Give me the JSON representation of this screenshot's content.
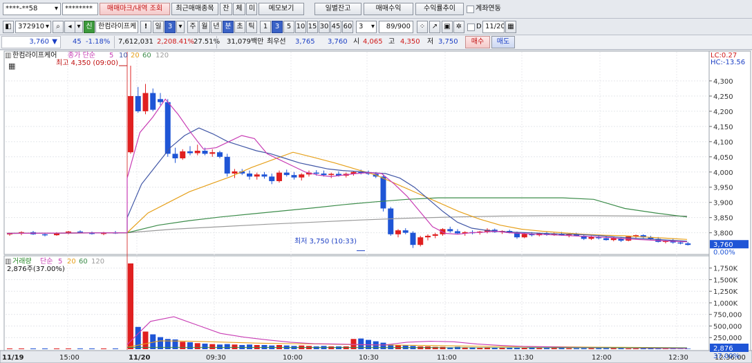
{
  "toolbar1": {
    "account_masked": "****-**58",
    "password_masked": "********",
    "trade_mark_btn": "매매마크/내역 조회",
    "recent_btn": "최근매매종목",
    "tab1": "잔",
    "tab2": "체",
    "tab3": "미",
    "memo_btn": "메모보기",
    "daily_balance_btn": "일별잔고",
    "trade_profit_btn": "매매수익",
    "return_trend_btn": "수익률추이",
    "account_link_label": "계좌연동"
  },
  "toolbar2": {
    "code": "372910",
    "name": "한컴라이프케",
    "exclaim": "!",
    "period_minute": "일",
    "period_value": "3",
    "periods": [
      "주",
      "월",
      "년",
      "분",
      "초",
      "틱"
    ],
    "intervals": [
      "1",
      "3",
      "5",
      "10",
      "15",
      "30",
      "45",
      "60"
    ],
    "interval_dropdown": "3",
    "count": "89",
    "count_total": "/900",
    "d_label": "D",
    "date": "11/20"
  },
  "quote": {
    "price": "3,760",
    "change": "45",
    "change_pct": "-1.18%",
    "volume": "7,612,031",
    "volume_ratio": "2,208.41%",
    "turnover_pct": "27.51%",
    "amount": "31,079백만",
    "best_bid_label": "최우선",
    "best_ask": "3,765",
    "best_bid": "3,760",
    "open_label": "시",
    "open": "4,065",
    "high_label": "고",
    "high": "4,350",
    "low_label": "저",
    "low": "3,750",
    "buy_btn": "매수",
    "sell_btn": "매도"
  },
  "price_panel": {
    "stock_name": "한컴라이프케어",
    "ma_label": "종가 단순",
    "ma_periods": [
      "5",
      "10",
      "20",
      "60",
      "120"
    ],
    "ma_colors": [
      "#c83cb4",
      "#4056a6",
      "#e6a01a",
      "#3c8c4a",
      "#9a9a9a"
    ],
    "lc": "LC:0.27",
    "hc": "HC:-13.56",
    "high_annotation": "최고 4,350 (09:00)",
    "low_annotation": "최저 3,750 (10:33)",
    "current_price_tag": "3,760",
    "current_pct_tag": "0.00%",
    "y_ticks": [
      "4,300",
      "4,250",
      "4,200",
      "4,150",
      "4,100",
      "4,050",
      "4,000",
      "3,950",
      "3,900",
      "3,850",
      "3,800"
    ]
  },
  "volume_panel": {
    "label": "거래량",
    "ma_label": "단순",
    "ma_periods": [
      "5",
      "20",
      "60",
      "120"
    ],
    "ma_colors": [
      "#c83cb4",
      "#e6a01a",
      "#3c8c4a",
      "#9a9a9a"
    ],
    "last_volume": "2,876주(37.00%)",
    "current_tag": "2,876",
    "current_tag2": "37.00%",
    "y_ticks": [
      "1,750K",
      "1,500K",
      "1,250K",
      "1,000K",
      "750,000",
      "500,000",
      "250,000"
    ]
  },
  "x_axis": {
    "labels": [
      "11/19",
      "15:00",
      "11/20",
      "09:30",
      "10:00",
      "10:30",
      "11:00",
      "11:30",
      "12:00",
      "12:30"
    ],
    "right_time": "12:36:00"
  },
  "chart_data": {
    "type": "candlestick",
    "price_ylim": [
      3740,
      4350
    ],
    "volume_ylim": [
      0,
      1850000
    ],
    "candles_prev_day": [
      {
        "o": 3795,
        "h": 3800,
        "l": 3790,
        "c": 3798
      },
      {
        "o": 3798,
        "h": 3805,
        "l": 3792,
        "c": 3802
      },
      {
        "o": 3802,
        "h": 3806,
        "l": 3793,
        "c": 3795
      },
      {
        "o": 3795,
        "h": 3800,
        "l": 3788,
        "c": 3792
      },
      {
        "o": 3792,
        "h": 3802,
        "l": 3790,
        "c": 3800
      },
      {
        "o": 3800,
        "h": 3806,
        "l": 3795,
        "c": 3804
      },
      {
        "o": 3804,
        "h": 3808,
        "l": 3798,
        "c": 3800
      },
      {
        "o": 3800,
        "h": 3804,
        "l": 3794,
        "c": 3796
      },
      {
        "o": 3796,
        "h": 3803,
        "l": 3792,
        "c": 3801
      },
      {
        "o": 3801,
        "h": 3806,
        "l": 3796,
        "c": 3798
      }
    ],
    "candles_today": [
      {
        "o": 4065,
        "h": 4350,
        "l": 4060,
        "c": 4250
      },
      {
        "o": 4250,
        "h": 4280,
        "l": 4195,
        "c": 4200
      },
      {
        "o": 4200,
        "h": 4290,
        "l": 4190,
        "c": 4260
      },
      {
        "o": 4260,
        "h": 4275,
        "l": 4200,
        "c": 4205
      },
      {
        "o": 4240,
        "h": 4260,
        "l": 4220,
        "c": 4230
      },
      {
        "o": 4230,
        "h": 4240,
        "l": 4050,
        "c": 4060
      },
      {
        "o": 4060,
        "h": 4080,
        "l": 4030,
        "c": 4045
      },
      {
        "o": 4045,
        "h": 4075,
        "l": 4040,
        "c": 4068
      },
      {
        "o": 4068,
        "h": 4085,
        "l": 4055,
        "c": 4062
      },
      {
        "o": 4062,
        "h": 4090,
        "l": 4055,
        "c": 4070
      },
      {
        "o": 4070,
        "h": 4080,
        "l": 4055,
        "c": 4060
      },
      {
        "o": 4060,
        "h": 4075,
        "l": 4050,
        "c": 4065
      },
      {
        "o": 4065,
        "h": 4070,
        "l": 4045,
        "c": 4050
      },
      {
        "o": 4050,
        "h": 4060,
        "l": 3985,
        "c": 3995
      },
      {
        "o": 3995,
        "h": 4010,
        "l": 3980,
        "c": 4002
      },
      {
        "o": 4002,
        "h": 4010,
        "l": 3990,
        "c": 3995
      },
      {
        "o": 3995,
        "h": 4005,
        "l": 3975,
        "c": 3985
      },
      {
        "o": 3985,
        "h": 3998,
        "l": 3975,
        "c": 3992
      },
      {
        "o": 3992,
        "h": 4000,
        "l": 3978,
        "c": 3985
      },
      {
        "o": 3985,
        "h": 3995,
        "l": 3960,
        "c": 3970
      },
      {
        "o": 3970,
        "h": 4005,
        "l": 3965,
        "c": 3998
      },
      {
        "o": 3998,
        "h": 4008,
        "l": 3985,
        "c": 3990
      },
      {
        "o": 3990,
        "h": 4000,
        "l": 3975,
        "c": 3982
      },
      {
        "o": 3982,
        "h": 3996,
        "l": 3972,
        "c": 3992
      },
      {
        "o": 3992,
        "h": 4005,
        "l": 3985,
        "c": 3998
      },
      {
        "o": 3998,
        "h": 4006,
        "l": 3988,
        "c": 3995
      },
      {
        "o": 3995,
        "h": 4005,
        "l": 3985,
        "c": 3990
      },
      {
        "o": 3990,
        "h": 3998,
        "l": 3980,
        "c": 3994
      },
      {
        "o": 3994,
        "h": 4002,
        "l": 3985,
        "c": 3988
      },
      {
        "o": 3988,
        "h": 3998,
        "l": 3982,
        "c": 3994
      },
      {
        "o": 3994,
        "h": 4004,
        "l": 3988,
        "c": 4000
      },
      {
        "o": 4000,
        "h": 4008,
        "l": 3992,
        "c": 3998
      },
      {
        "o": 3998,
        "h": 4005,
        "l": 3990,
        "c": 3994
      },
      {
        "o": 3994,
        "h": 4000,
        "l": 3980,
        "c": 3985
      },
      {
        "o": 3985,
        "h": 3990,
        "l": 3870,
        "c": 3880
      },
      {
        "o": 3880,
        "h": 3885,
        "l": 3790,
        "c": 3795
      },
      {
        "o": 3795,
        "h": 3812,
        "l": 3785,
        "c": 3808
      },
      {
        "o": 3808,
        "h": 3815,
        "l": 3795,
        "c": 3800
      },
      {
        "o": 3800,
        "h": 3805,
        "l": 3750,
        "c": 3760
      },
      {
        "o": 3760,
        "h": 3790,
        "l": 3755,
        "c": 3785
      },
      {
        "o": 3785,
        "h": 3795,
        "l": 3775,
        "c": 3790
      },
      {
        "o": 3790,
        "h": 3800,
        "l": 3782,
        "c": 3795
      },
      {
        "o": 3795,
        "h": 3815,
        "l": 3790,
        "c": 3812
      },
      {
        "o": 3812,
        "h": 3820,
        "l": 3800,
        "c": 3805
      },
      {
        "o": 3805,
        "h": 3812,
        "l": 3795,
        "c": 3798
      },
      {
        "o": 3798,
        "h": 3805,
        "l": 3790,
        "c": 3802
      },
      {
        "o": 3802,
        "h": 3808,
        "l": 3795,
        "c": 3800
      },
      {
        "o": 3800,
        "h": 3806,
        "l": 3794,
        "c": 3804
      },
      {
        "o": 3804,
        "h": 3815,
        "l": 3798,
        "c": 3810
      },
      {
        "o": 3810,
        "h": 3814,
        "l": 3800,
        "c": 3802
      },
      {
        "o": 3802,
        "h": 3808,
        "l": 3796,
        "c": 3806
      },
      {
        "o": 3806,
        "h": 3810,
        "l": 3798,
        "c": 3800
      },
      {
        "o": 3800,
        "h": 3804,
        "l": 3780,
        "c": 3785
      },
      {
        "o": 3785,
        "h": 3800,
        "l": 3782,
        "c": 3796
      },
      {
        "o": 3796,
        "h": 3802,
        "l": 3788,
        "c": 3792
      },
      {
        "o": 3792,
        "h": 3800,
        "l": 3788,
        "c": 3798
      },
      {
        "o": 3798,
        "h": 3804,
        "l": 3790,
        "c": 3794
      },
      {
        "o": 3794,
        "h": 3800,
        "l": 3790,
        "c": 3797
      },
      {
        "o": 3797,
        "h": 3803,
        "l": 3790,
        "c": 3792
      },
      {
        "o": 3792,
        "h": 3798,
        "l": 3785,
        "c": 3795
      },
      {
        "o": 3795,
        "h": 3800,
        "l": 3788,
        "c": 3790
      },
      {
        "o": 3790,
        "h": 3796,
        "l": 3776,
        "c": 3780
      },
      {
        "o": 3780,
        "h": 3790,
        "l": 3776,
        "c": 3786
      },
      {
        "o": 3786,
        "h": 3792,
        "l": 3778,
        "c": 3782
      },
      {
        "o": 3782,
        "h": 3788,
        "l": 3774,
        "c": 3776
      },
      {
        "o": 3776,
        "h": 3786,
        "l": 3772,
        "c": 3782
      },
      {
        "o": 3782,
        "h": 3786,
        "l": 3770,
        "c": 3774
      },
      {
        "o": 3774,
        "h": 3790,
        "l": 3772,
        "c": 3788
      },
      {
        "o": 3788,
        "h": 3794,
        "l": 3780,
        "c": 3792
      },
      {
        "o": 3792,
        "h": 3795,
        "l": 3782,
        "c": 3785
      },
      {
        "o": 3785,
        "h": 3790,
        "l": 3775,
        "c": 3780
      },
      {
        "o": 3780,
        "h": 3786,
        "l": 3768,
        "c": 3770
      },
      {
        "o": 3770,
        "h": 3776,
        "l": 3765,
        "c": 3774
      },
      {
        "o": 3774,
        "h": 3780,
        "l": 3764,
        "c": 3768
      },
      {
        "o": 3768,
        "h": 3774,
        "l": 3762,
        "c": 3765
      },
      {
        "o": 3765,
        "h": 3770,
        "l": 3758,
        "c": 3760
      }
    ],
    "ma5": [
      3980,
      4130,
      4180,
      4240,
      4190,
      4130,
      4075,
      4080,
      4100,
      4120,
      4110,
      4060,
      4040,
      4020,
      4000,
      3990,
      3985,
      3990,
      3995,
      3998,
      3995,
      3960,
      3920,
      3870,
      3820,
      3798,
      3795,
      3800,
      3802,
      3805,
      3800,
      3798,
      3795,
      3794,
      3792,
      3790,
      3788,
      3786,
      3784,
      3780,
      3778,
      3776,
      3774,
      3772,
      3770
    ],
    "ma10": [
      3850,
      3960,
      4020,
      4080,
      4120,
      4145,
      4125,
      4100,
      4085,
      4070,
      4060,
      4045,
      4030,
      4020,
      4010,
      4005,
      4002,
      3998,
      3995,
      3980,
      3950,
      3910,
      3870,
      3835,
      3815,
      3808,
      3804,
      3802,
      3800,
      3798,
      3796,
      3795,
      3793,
      3790,
      3786,
      3783,
      3780,
      3778,
      3775,
      3772
    ],
    "ma20": [
      3800,
      3865,
      3900,
      3935,
      3960,
      3985,
      4015,
      4040,
      4065,
      4048,
      4030,
      4010,
      3990,
      3960,
      3930,
      3900,
      3870,
      3845,
      3825,
      3812,
      3805,
      3800,
      3795,
      3792,
      3790,
      3786,
      3782,
      3778
    ],
    "ma60": [
      3800,
      3825,
      3840,
      3852,
      3862,
      3872,
      3882,
      3893,
      3902,
      3910,
      3915,
      3915,
      3915,
      3915,
      3915,
      3910,
      3880,
      3865,
      3852
    ],
    "ma120": [
      3800,
      3812,
      3820,
      3828,
      3835,
      3842,
      3848,
      3852,
      3855,
      3856,
      3856,
      3855,
      3855
    ]
  }
}
